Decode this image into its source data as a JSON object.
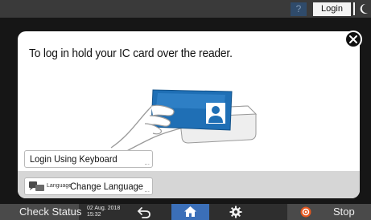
{
  "top_bar": {
    "help_label": "?",
    "login_label": "Login"
  },
  "dialog": {
    "message": "To log in hold your IC card over the reader.",
    "login_keyboard_label": "Login Using Keyboard",
    "login_keyboard_dots": "...",
    "language_small_label": "Language",
    "change_language_label": "Change Language",
    "change_language_dots": "..."
  },
  "bottom_bar": {
    "check_status_label": "Check Status",
    "date": "02 Aug. 2018",
    "time": "15:32",
    "stop_label": "Stop"
  },
  "colors": {
    "home_active": "#3b6fb8",
    "card_blue": "#1f6fb5",
    "stop_icon": "#e4571f"
  },
  "icons": [
    "help-icon",
    "moon-icon",
    "close-icon",
    "ic-card-illustration",
    "language-icon",
    "back-icon",
    "home-icon",
    "gear-icon",
    "stop-icon"
  ]
}
